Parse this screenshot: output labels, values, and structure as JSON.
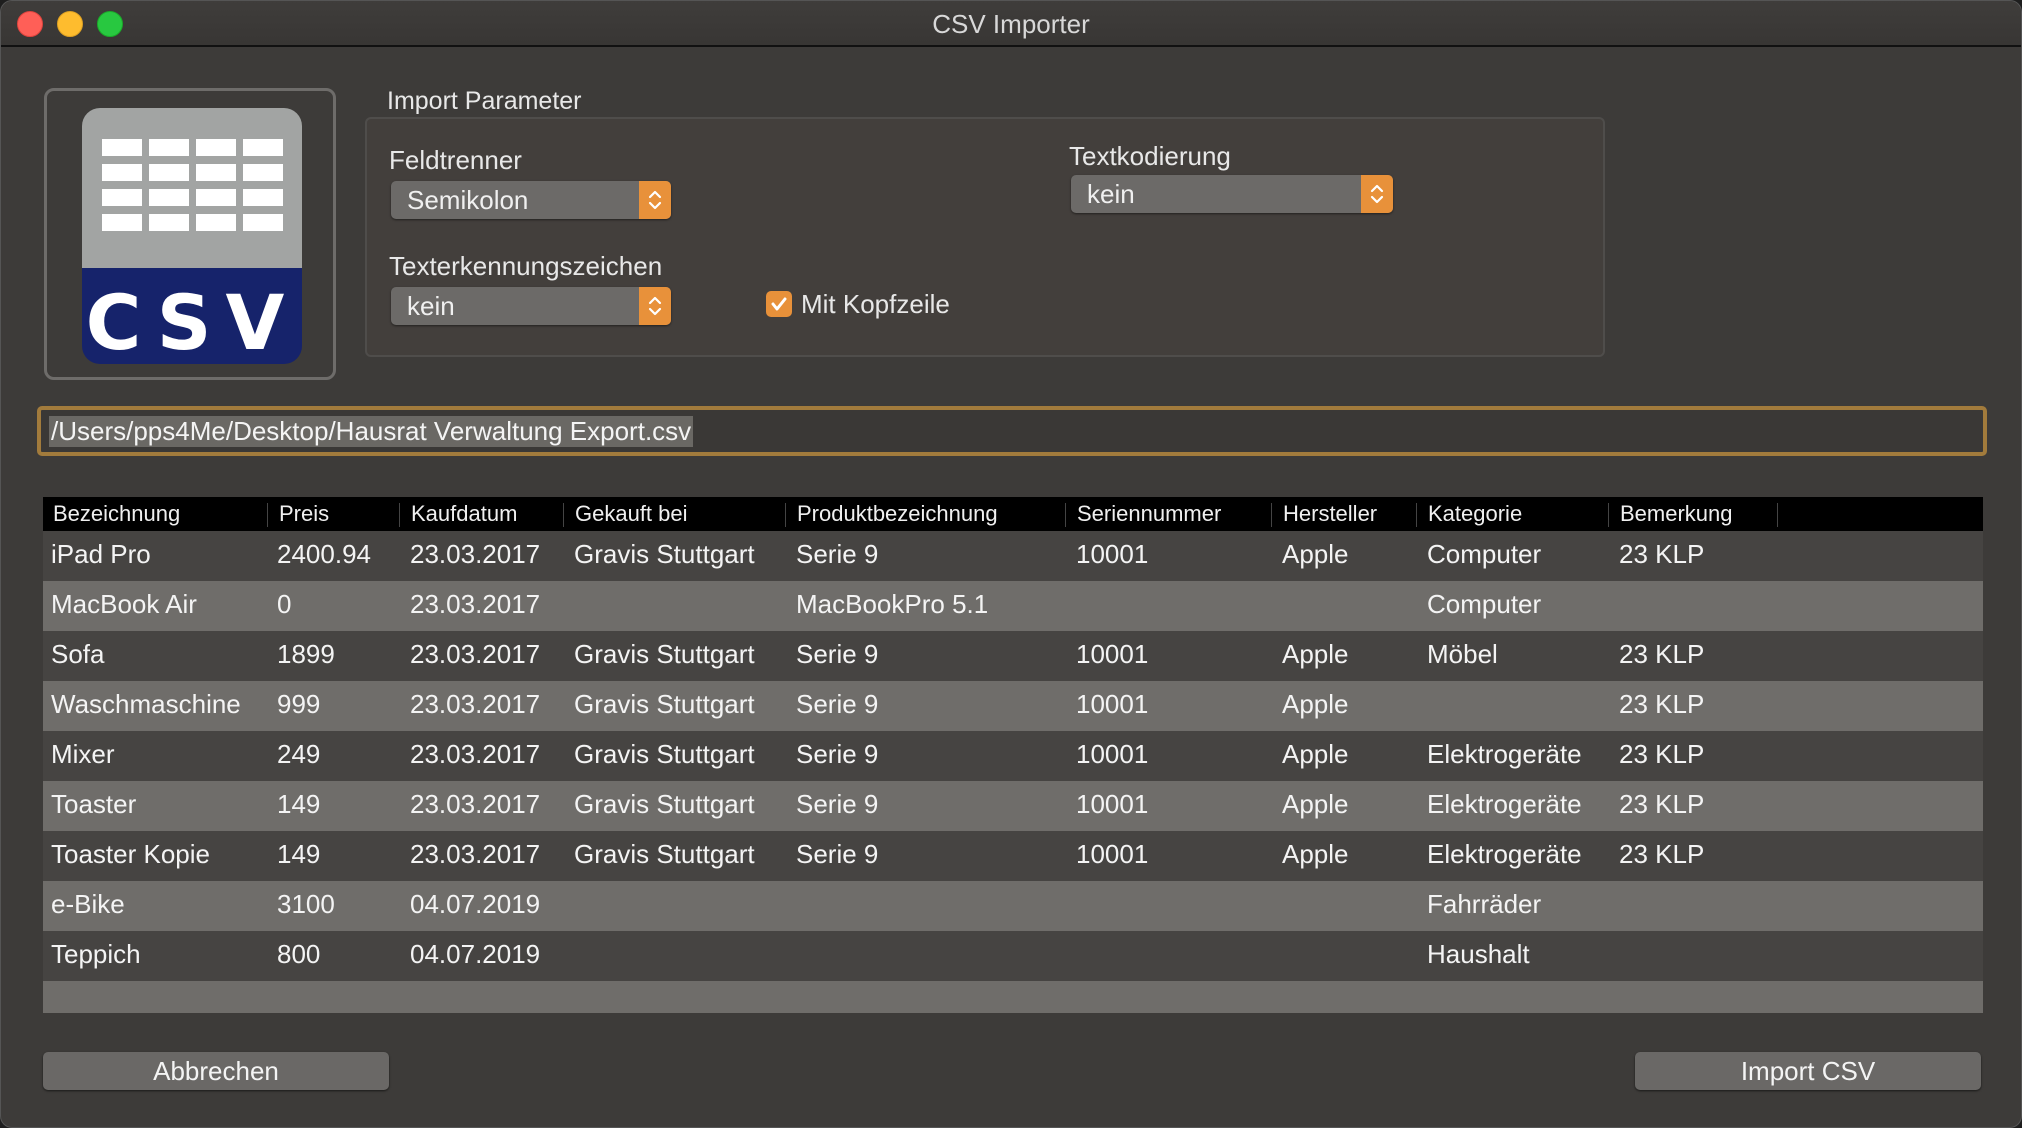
{
  "window": {
    "title": "CSV Importer"
  },
  "logo": {
    "text": "CSV"
  },
  "params": {
    "group_label": "Import Parameter",
    "feldtrenner": {
      "label": "Feldtrenner",
      "value": "Semikolon"
    },
    "textkodierung": {
      "label": "Textkodierung",
      "value": "kein"
    },
    "texterkennung": {
      "label": "Texterkennungszeichen",
      "value": "kein"
    },
    "kopfzeile": {
      "label": "Mit Kopfzeile",
      "checked": true
    }
  },
  "file_path": "/Users/pps4Me/Desktop/Hausrat Verwaltung Export.csv",
  "table": {
    "columns": [
      "Bezeichnung",
      "Preis",
      "Kaufdatum",
      "Gekauft bei",
      "Produktbezeichnung",
      "Seriennummer",
      "Hersteller",
      "Kategorie",
      "Bemerkung"
    ],
    "rows": [
      [
        "iPad Pro",
        "2400.94",
        "23.03.2017",
        "Gravis Stuttgart",
        "Serie 9",
        "10001",
        "Apple",
        "Computer",
        "23 KLP"
      ],
      [
        "MacBook Air",
        "0",
        "23.03.2017",
        "",
        "MacBookPro 5.1",
        "",
        "",
        "Computer",
        ""
      ],
      [
        "Sofa",
        "1899",
        "23.03.2017",
        "Gravis Stuttgart",
        "Serie 9",
        "10001",
        "Apple",
        "Möbel",
        "23 KLP"
      ],
      [
        "Waschmaschine",
        "999",
        "23.03.2017",
        "Gravis Stuttgart",
        "Serie 9",
        "10001",
        "Apple",
        "",
        "23 KLP"
      ],
      [
        "Mixer",
        "249",
        "23.03.2017",
        "Gravis Stuttgart",
        "Serie 9",
        "10001",
        "Apple",
        "Elektrogeräte",
        "23 KLP"
      ],
      [
        "Toaster",
        "149",
        "23.03.2017",
        "Gravis Stuttgart",
        "Serie 9",
        "10001",
        "Apple",
        "Elektrogeräte",
        "23 KLP"
      ],
      [
        "Toaster Kopie",
        "149",
        "23.03.2017",
        "Gravis Stuttgart",
        "Serie 9",
        "10001",
        "Apple",
        "Elektrogeräte",
        "23 KLP"
      ],
      [
        "e-Bike",
        "3100",
        "04.07.2019",
        "",
        "",
        "",
        "",
        "Fahrräder",
        ""
      ],
      [
        "Teppich",
        "800",
        "04.07.2019",
        "",
        "",
        "",
        "",
        "Haushalt",
        ""
      ]
    ]
  },
  "buttons": {
    "cancel": "Abbrechen",
    "import": "Import CSV"
  },
  "colors": {
    "accent": "#e8913a",
    "window_bg": "#3d3b39",
    "logo_blue": "#16236b"
  }
}
